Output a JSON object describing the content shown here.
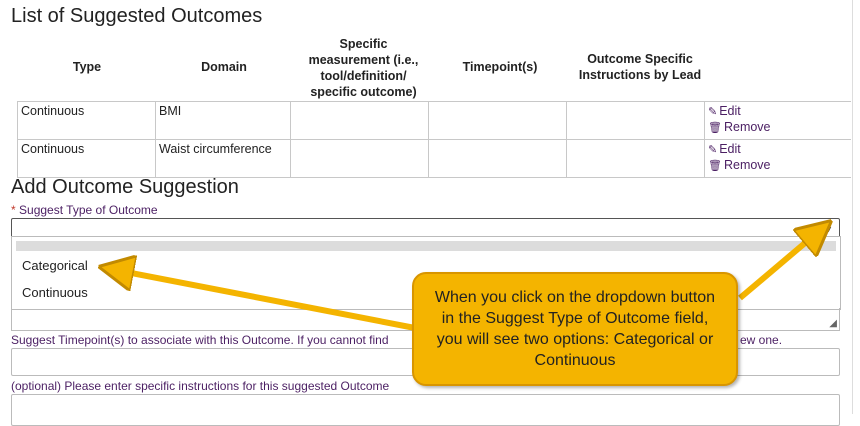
{
  "list_title": "List of Suggested Outcomes",
  "table": {
    "headers": [
      "Type",
      "Domain",
      "Specific measurement (i.e., tool/definition/ specific outcome)",
      "Timepoint(s)",
      "Outcome Specific Instructions by Lead"
    ],
    "rows": [
      {
        "type": "Continuous",
        "domain": "BMI",
        "measurement": "",
        "timepoints": "",
        "instructions": "",
        "edit": "Edit",
        "remove": "Remove"
      },
      {
        "type": "Continuous",
        "domain": "Waist circumference",
        "measurement": "",
        "timepoints": "",
        "instructions": "",
        "edit": "Edit",
        "remove": "Remove"
      }
    ]
  },
  "add_title": "Add Outcome Suggestion",
  "type_field": {
    "required_mark": "*",
    "label": "Suggest Type of Outcome",
    "value": "",
    "options": [
      "Categorical",
      "Continuous"
    ]
  },
  "timepoint_label_left": "Suggest Timepoint(s) to associate with this Outcome. If you cannot find",
  "timepoint_label_right": "ew one.",
  "instructions_label": "(optional) Please enter specific instructions for this suggested Outcome",
  "callout_text": "When you click on the dropdown button in the Suggest Type of Outcome field, you will see two options: Categorical or Continuous",
  "colors": {
    "callout": "#f4b400",
    "label_purple": "#4b1f63",
    "arrow": "#f4b400"
  }
}
